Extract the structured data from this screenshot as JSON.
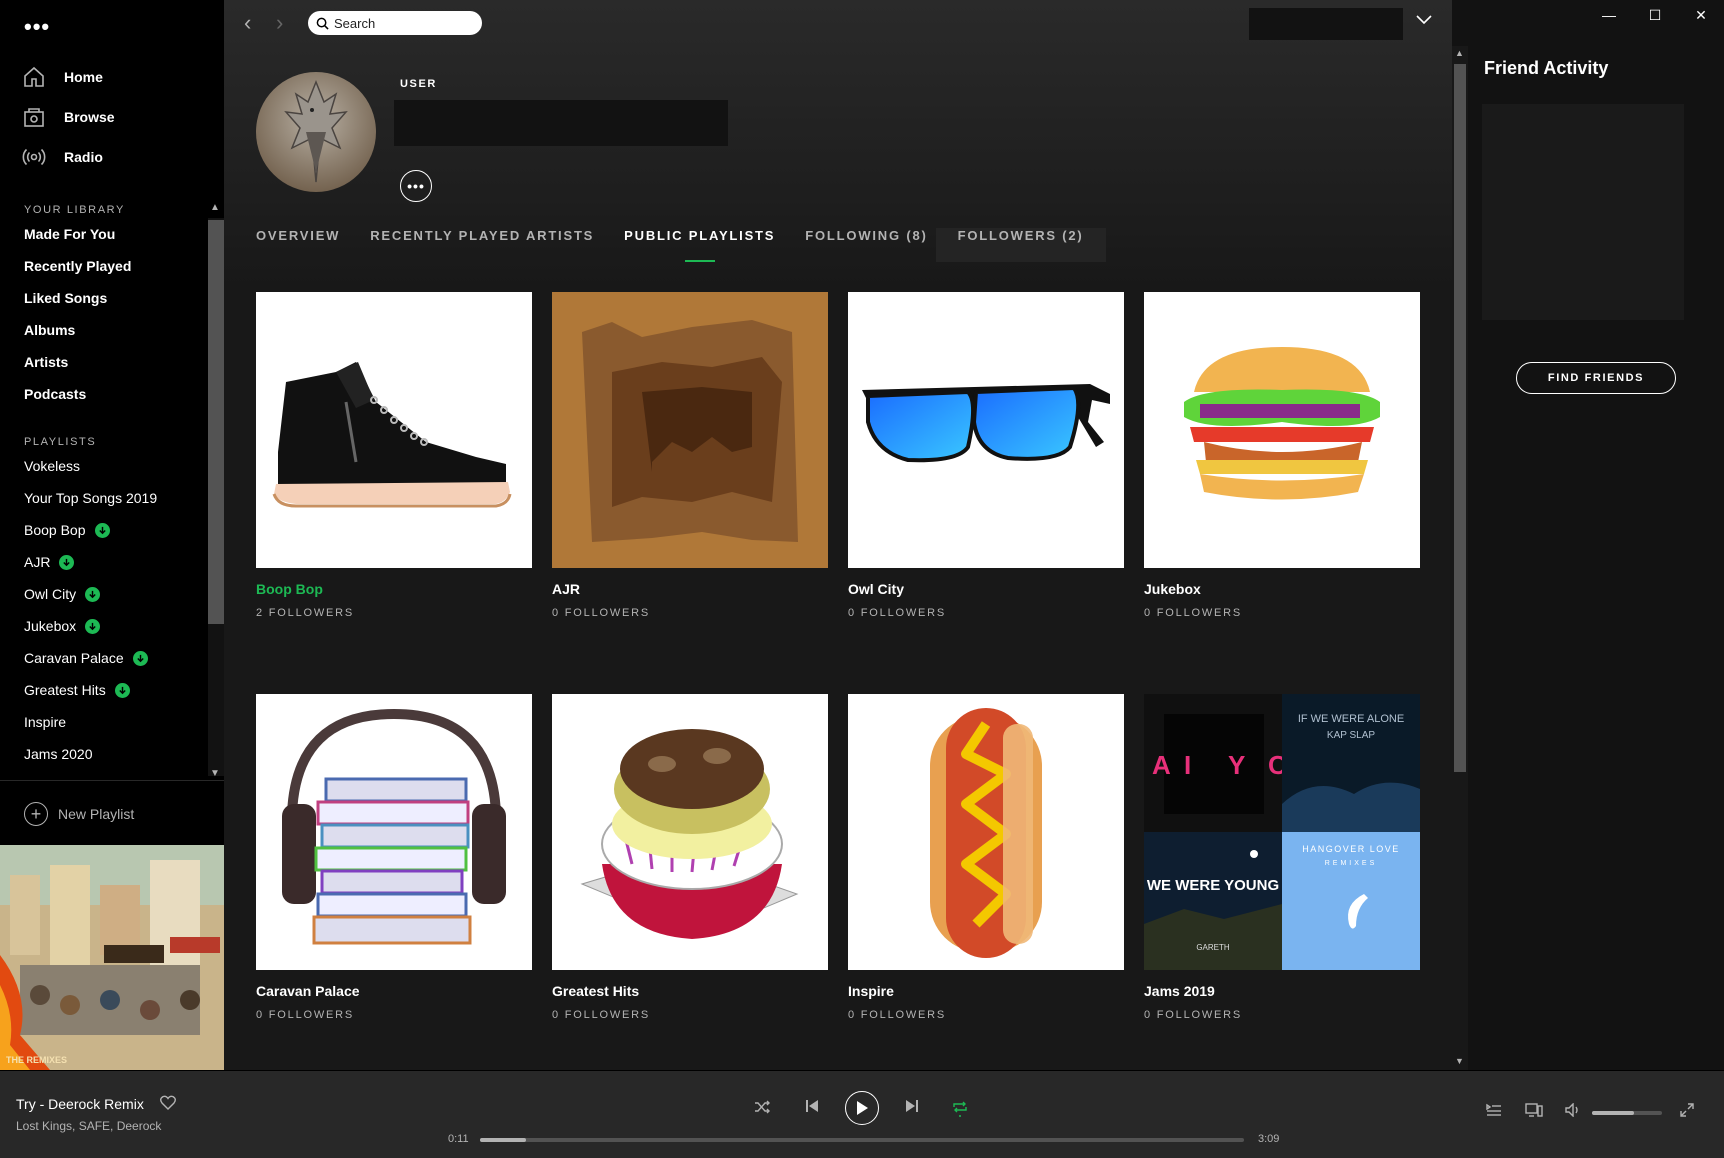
{
  "sidebar": {
    "nav": [
      {
        "label": "Home",
        "icon": "home-icon"
      },
      {
        "label": "Browse",
        "icon": "browse-icon"
      },
      {
        "label": "Radio",
        "icon": "radio-icon"
      }
    ],
    "library_title": "YOUR LIBRARY",
    "library": [
      "Made For You",
      "Recently Played",
      "Liked Songs",
      "Albums",
      "Artists",
      "Podcasts"
    ],
    "playlists_title": "PLAYLISTS",
    "playlists": [
      {
        "label": "Vokeless",
        "downloaded": false
      },
      {
        "label": "Your Top Songs 2019",
        "downloaded": false
      },
      {
        "label": "Boop Bop",
        "downloaded": true
      },
      {
        "label": "AJR",
        "downloaded": true
      },
      {
        "label": "Owl City",
        "downloaded": true
      },
      {
        "label": "Jukebox",
        "downloaded": true
      },
      {
        "label": "Caravan Palace",
        "downloaded": true
      },
      {
        "label": "Greatest Hits",
        "downloaded": true
      },
      {
        "label": "Inspire",
        "downloaded": false
      },
      {
        "label": "Jams 2020",
        "downloaded": false
      }
    ],
    "new_playlist": "New Playlist",
    "album_art_caption": "THE REMIXES"
  },
  "topbar": {
    "search_placeholder": "Search"
  },
  "profile": {
    "type_label": "USER",
    "username": ""
  },
  "tabs": [
    {
      "label": "OVERVIEW",
      "active": false
    },
    {
      "label": "RECENTLY PLAYED ARTISTS",
      "active": false
    },
    {
      "label": "PUBLIC PLAYLISTS",
      "active": true
    },
    {
      "label": "FOLLOWING (8)",
      "active": false
    },
    {
      "label": "FOLLOWERS (2)",
      "active": false
    }
  ],
  "playlists_grid": [
    {
      "title": "Boop Bop",
      "followers": "2 FOLLOWERS",
      "art": "sneaker",
      "playing": true
    },
    {
      "title": "AJR",
      "followers": "0 FOLLOWERS",
      "art": "cave",
      "playing": false
    },
    {
      "title": "Owl City",
      "followers": "0 FOLLOWERS",
      "art": "sunglasses",
      "playing": false
    },
    {
      "title": "Jukebox",
      "followers": "0 FOLLOWERS",
      "art": "burger",
      "playing": false
    },
    {
      "title": "Caravan Palace",
      "followers": "0 FOLLOWERS",
      "art": "books-headphones",
      "playing": false
    },
    {
      "title": "Greatest Hits",
      "followers": "0 FOLLOWERS",
      "art": "donut-sandwich",
      "playing": false
    },
    {
      "title": "Inspire",
      "followers": "0 FOLLOWERS",
      "art": "hotdog",
      "playing": false
    },
    {
      "title": "Jams 2019",
      "followers": "0 FOLLOWERS",
      "art": "mosaic",
      "playing": false
    }
  ],
  "mosaic_text": {
    "tile2": "IF WE WERE ALONE",
    "tile2_sub": "KAP SLAP",
    "tile3": "WE WERE YOUNG",
    "tile3_sub": "GARETH",
    "tile4": "HANGOVER LOVE",
    "tile4_sub": "REMIXES"
  },
  "friend_activity": {
    "title": "Friend Activity",
    "find_friends": "FIND FRIENDS"
  },
  "player": {
    "track_title": "Try - Deerock Remix",
    "artists": "Lost Kings, SAFE, Deerock",
    "current_time": "0:11",
    "total_time": "3:09",
    "progress": 0.06,
    "volume": 0.6,
    "repeat_active": true
  },
  "colors": {
    "accent": "#1db954",
    "sidebar_bg": "#000000",
    "main_bg": "#181818",
    "player_bg": "#282828"
  }
}
